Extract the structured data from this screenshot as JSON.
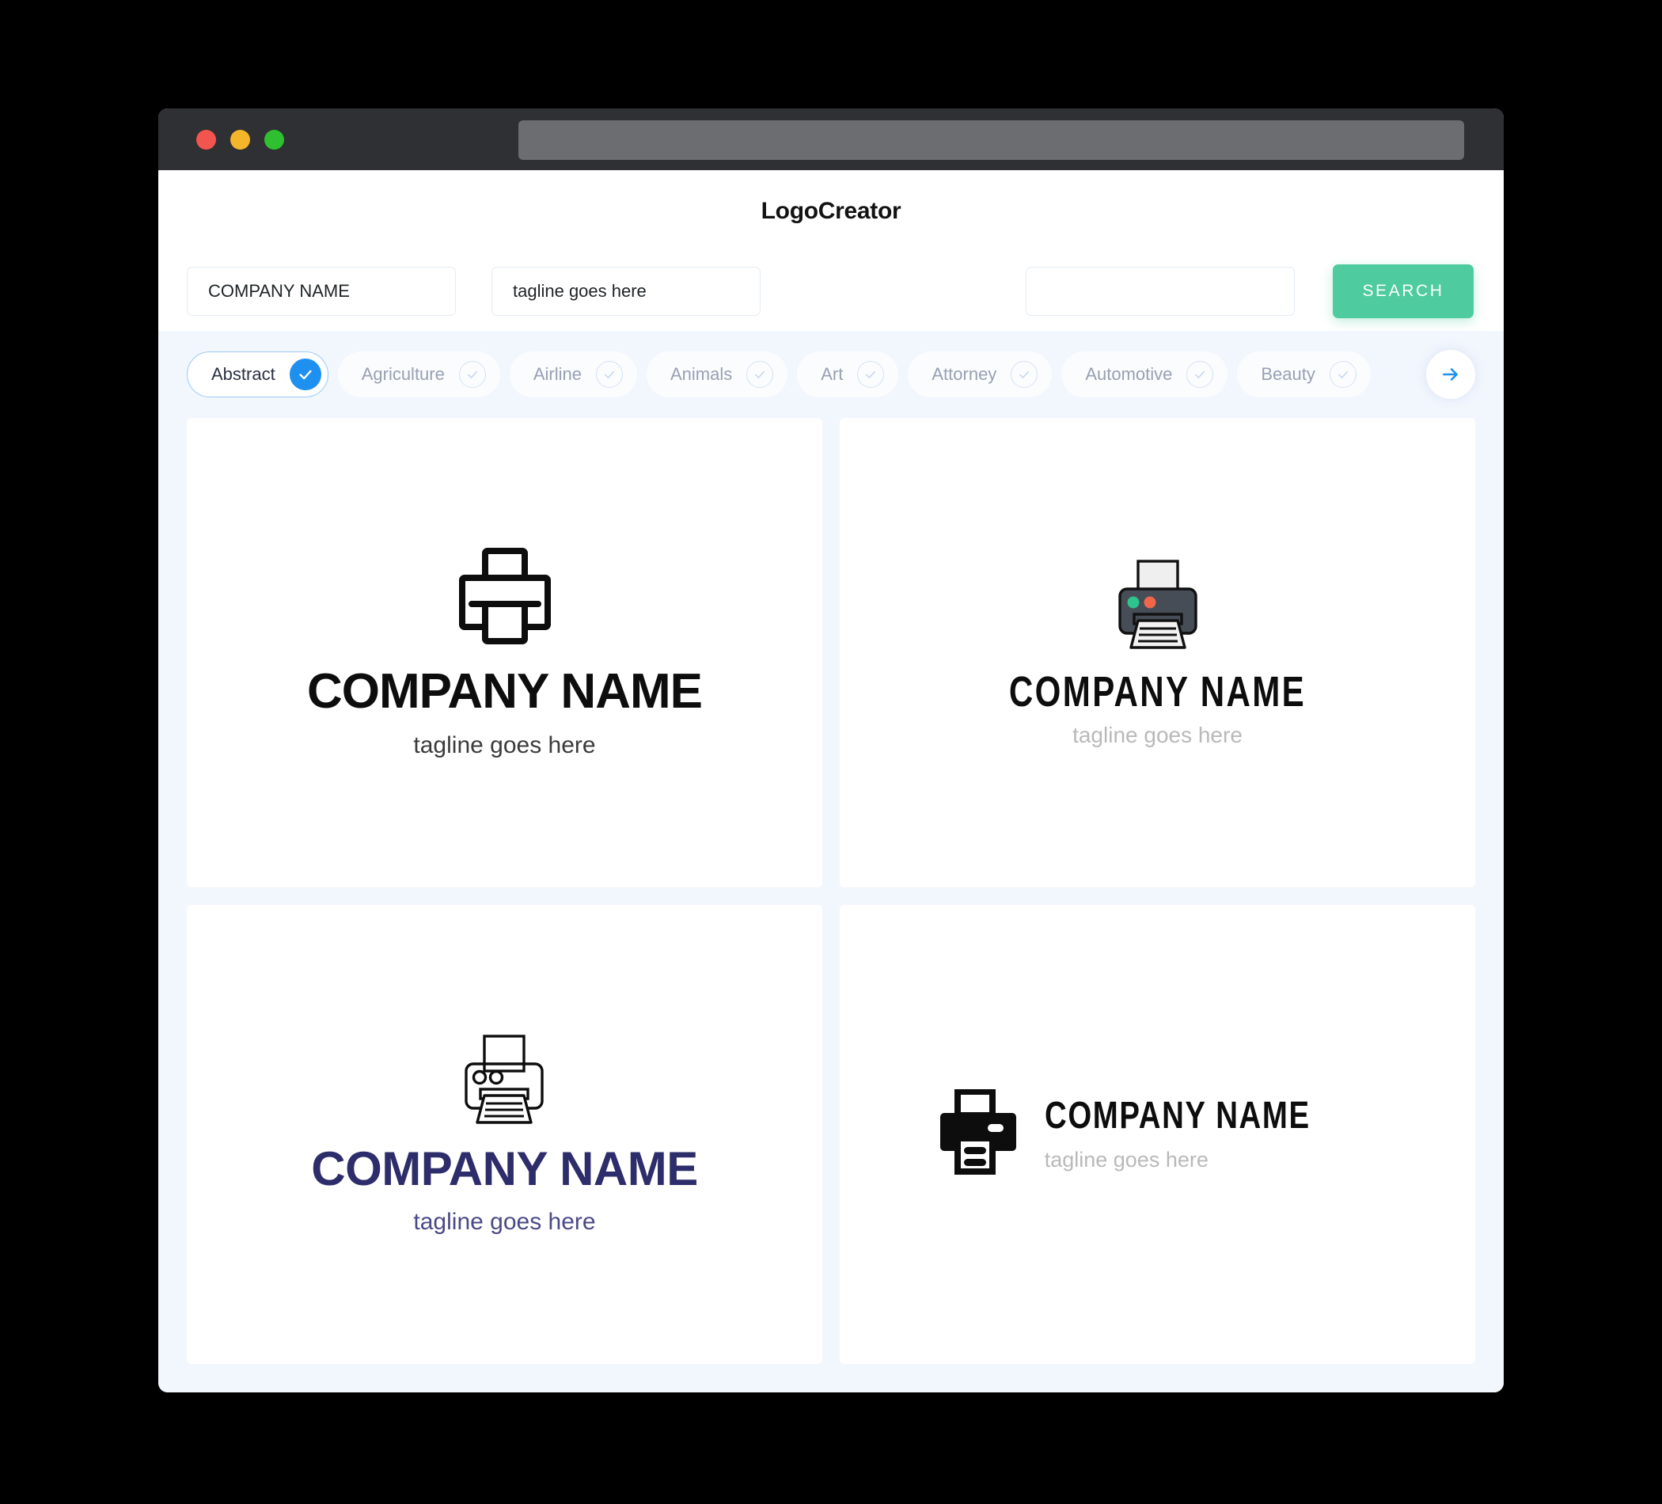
{
  "window": {
    "traffic_lights": [
      {
        "name": "close",
        "color": "#f2554e"
      },
      {
        "name": "minimize",
        "color": "#f5b52b"
      },
      {
        "name": "maximize",
        "color": "#2ec02f"
      }
    ],
    "url_value": ""
  },
  "header": {
    "title": "LogoCreator"
  },
  "search": {
    "company_value": "COMPANY NAME",
    "company_placeholder": "COMPANY NAME",
    "tagline_value": "tagline goes here",
    "tagline_placeholder": "tagline goes here",
    "extra_value": "",
    "extra_placeholder": "",
    "button_label": "SEARCH",
    "button_color": "#4ecb9f"
  },
  "categories": {
    "accent_color": "#1e90f0",
    "next_label": "next-categories",
    "items": [
      {
        "label": "Abstract",
        "selected": true
      },
      {
        "label": "Agriculture",
        "selected": false
      },
      {
        "label": "Airline",
        "selected": false
      },
      {
        "label": "Animals",
        "selected": false
      },
      {
        "label": "Art",
        "selected": false
      },
      {
        "label": "Attorney",
        "selected": false
      },
      {
        "label": "Automotive",
        "selected": false
      },
      {
        "label": "Beauty",
        "selected": false
      }
    ]
  },
  "results": [
    {
      "id": "logo-1",
      "icon": "printer-outline-icon",
      "layout": "vertical",
      "company_name": "COMPANY NAME",
      "tagline": "tagline goes here",
      "name_color": "#0d0d0d",
      "tagline_color": "#3b3b3b"
    },
    {
      "id": "logo-2",
      "icon": "printer-color-icon",
      "layout": "vertical",
      "company_name": "COMPANY NAME",
      "tagline": "tagline goes here",
      "name_color": "#0d0d0d",
      "tagline_color": "#b9b9b9"
    },
    {
      "id": "logo-3",
      "icon": "printer-line-icon",
      "layout": "vertical",
      "company_name": "COMPANY NAME",
      "tagline": "tagline goes here",
      "name_color": "#2e2d6b",
      "tagline_color": "#4a4a86"
    },
    {
      "id": "logo-4",
      "icon": "printer-solid-icon",
      "layout": "horizontal",
      "company_name": "COMPANY NAME",
      "tagline": "tagline goes here",
      "name_color": "#0d0d0d",
      "tagline_color": "#b9b9b9"
    }
  ]
}
